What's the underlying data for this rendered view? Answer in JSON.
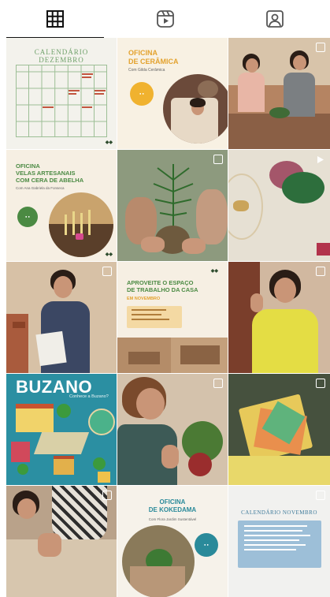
{
  "tabs": [
    {
      "icon": "grid-icon",
      "active": true
    },
    {
      "icon": "reels-icon",
      "active": false
    },
    {
      "icon": "tagged-icon",
      "active": false
    }
  ],
  "posts": {
    "calendar_dec": {
      "title_line1": "CALENDÁRIO",
      "title_line2": "DEZEMBRO"
    },
    "ceramica": {
      "title_line1": "OFICINA",
      "title_line2": "DE CERÂMICA",
      "subtitle": "Com Gilda Cerâmica"
    },
    "velas": {
      "title_line1": "OFICINA",
      "title_line2": "VELAS ARTESANAIS",
      "title_line3": "COM CERA DE ABELHA",
      "subtitle": "Com Ana Gabriela da Fonseca"
    },
    "espaco": {
      "title_line1": "APROVEITE O ESPAÇO",
      "title_line2": "DE TRABALHO DA CASA",
      "tag": "EM NOVEMBRO"
    },
    "buzano": {
      "title": "BUZANO",
      "subtitle": "Conhece a Buzano?"
    },
    "kokedama": {
      "title_line1": "OFICINA",
      "title_line2": "DE KOKEDAMA",
      "subtitle": "Com Flora Jardim Sustentável"
    },
    "calendar_nov": {
      "title": "CALENDÁRIO NOVEMBRO"
    }
  },
  "colors": {
    "green": "#4b8a43",
    "cream": "#f7efe2",
    "teal": "#2a8a9a"
  }
}
